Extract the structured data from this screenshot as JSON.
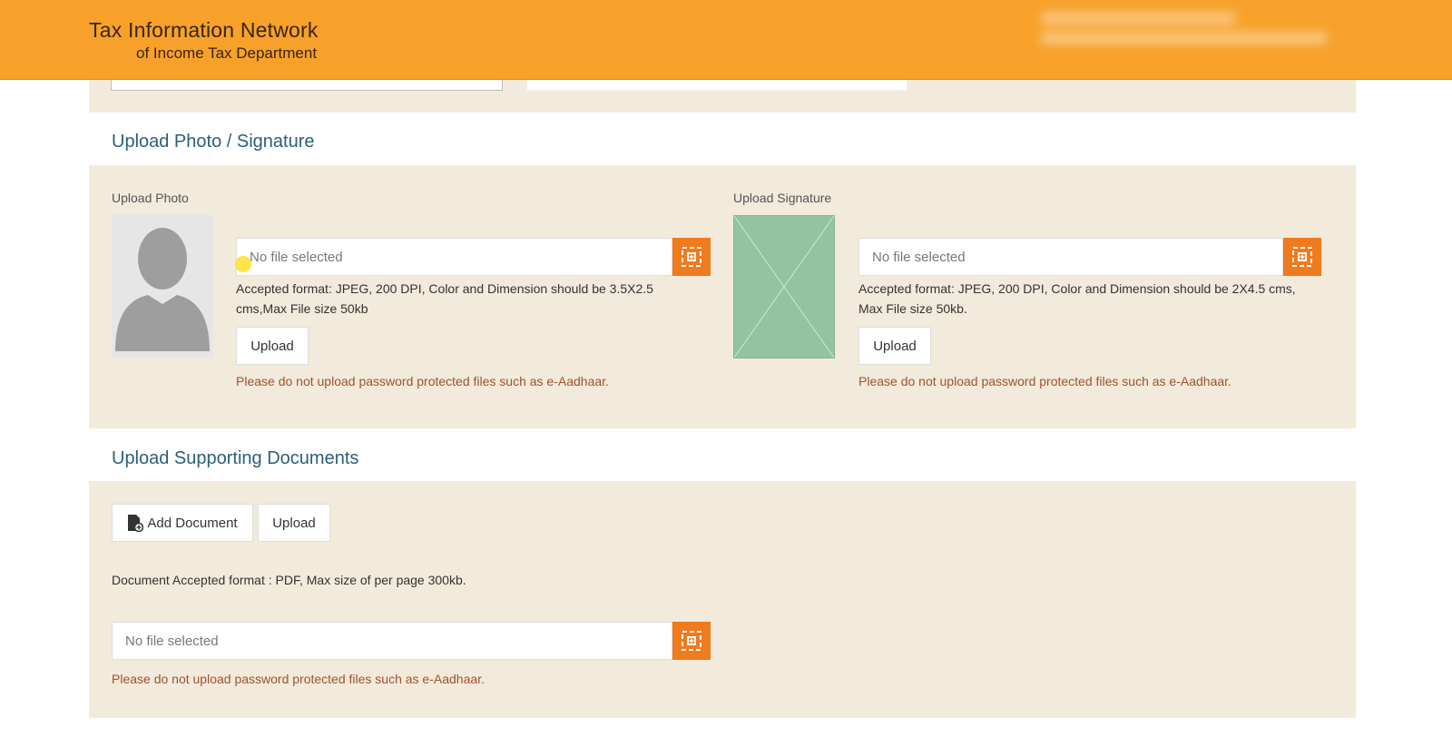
{
  "header": {
    "title": "Tax Information Network",
    "subtitle": "of Income Tax Department",
    "accent_color": "#f7a12a"
  },
  "photo_section": {
    "title": "Upload Photo / Signature",
    "photo": {
      "label": "Upload Photo",
      "placeholder": "No file selected",
      "hint": "Accepted format: JPEG, 200 DPI, Color and Dimension should be 3.5X2.5 cms,Max File size 50kb",
      "upload_label": "Upload",
      "warning": "Please do not upload password protected files such as e-Aadhaar."
    },
    "signature": {
      "label": "Upload Signature",
      "placeholder": "No file selected",
      "hint": "Accepted format: JPEG, 200 DPI, Color and Dimension should be 2X4.5 cms, Max File size 50kb.",
      "upload_label": "Upload",
      "warning": "Please do not upload password protected files such as e-Aadhaar."
    }
  },
  "docs_section": {
    "title": "Upload Supporting Documents",
    "add_label": "Add Document",
    "upload_label": "Upload",
    "format_note": "Document Accepted format : PDF, Max size of per page 300kb.",
    "placeholder": "No file selected",
    "warning": "Please do not upload password protected files such as e-Aadhaar."
  },
  "icons": {
    "browse": "file-browse-icon",
    "add_document": "document-add-icon",
    "avatar": "user-silhouette-icon",
    "signature_placeholder": "image-placeholder-icon"
  },
  "colors": {
    "browse_button": "#f07a1e",
    "section_title": "#2b5f7a",
    "warning_text": "#a0522d",
    "band": "#f2eadb"
  }
}
